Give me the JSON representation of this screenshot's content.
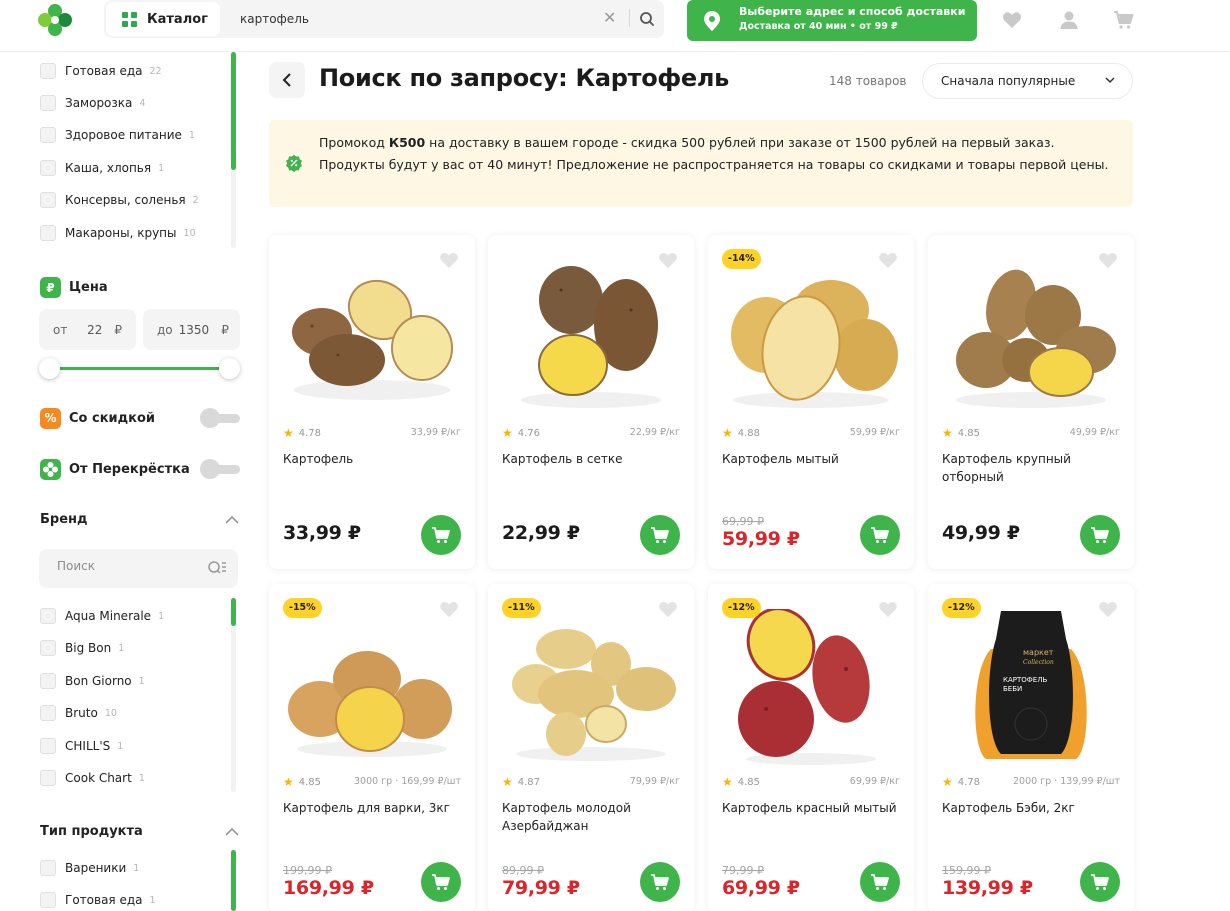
{
  "header": {
    "catalog_label": "Каталог",
    "search_value": "картофель",
    "delivery_title": "Выберите адрес и способ доставки",
    "delivery_sub": "Доставка от 40 мин • от 99 ₽"
  },
  "sidebar": {
    "categories": [
      {
        "label": "Готовая еда",
        "count": "22"
      },
      {
        "label": "Заморозка",
        "count": "4"
      },
      {
        "label": "Здоровое питание",
        "count": "1"
      },
      {
        "label": "Каша, хлопья",
        "count": "1"
      },
      {
        "label": "Консервы, соленья",
        "count": "2"
      },
      {
        "label": "Макароны, крупы",
        "count": "10"
      }
    ],
    "price": {
      "title": "Цена",
      "from_label": "от",
      "from_value": "22",
      "to_label": "до",
      "to_value": "1350",
      "currency": "₽"
    },
    "discount_toggle": "Со скидкой",
    "own_brand_toggle": "От Перекрёстка",
    "brand": {
      "title": "Бренд",
      "search_placeholder": "Поиск",
      "items": [
        {
          "label": "Aqua Minerale",
          "count": "1"
        },
        {
          "label": "Big Bon",
          "count": "1"
        },
        {
          "label": "Bon Giorno",
          "count": "1"
        },
        {
          "label": "Bruto",
          "count": "10"
        },
        {
          "label": "CHILL'S",
          "count": "1"
        },
        {
          "label": "Cook Chart",
          "count": "1"
        }
      ]
    },
    "product_type": {
      "title": "Тип продукта",
      "items": [
        {
          "label": "Вареники",
          "count": "1"
        },
        {
          "label": "Готовая еда",
          "count": "1"
        }
      ]
    }
  },
  "main": {
    "title": "Поиск по запросу:  Картофель",
    "count": "148 товаров",
    "sort": "Сначала популярные",
    "promo": {
      "pre": "Промокод ",
      "code": "К500",
      "post": " на доставку в вашем городе - скидка 500 рублей при заказе от 1500 рублей на первый заказ. Продукты будут у вас от 40 минут! Предложение не распространяется на товары со скидками и товары первой цены."
    }
  },
  "products": [
    {
      "name": "Картофель",
      "rating": "4.78",
      "unit": "33,99 ₽/кг",
      "price": "33,99 ₽",
      "old_price": "",
      "discount": ""
    },
    {
      "name": "Картофель в сетке",
      "rating": "4.76",
      "unit": "22,99 ₽/кг",
      "price": "22,99 ₽",
      "old_price": "",
      "discount": ""
    },
    {
      "name": "Картофель мытый",
      "rating": "4.88",
      "unit": "59,99 ₽/кг",
      "price": "59,99 ₽",
      "old_price": "69,99 ₽",
      "discount": "-14%"
    },
    {
      "name": "Картофель крупный отборный",
      "rating": "4.85",
      "unit": "49,99 ₽/кг",
      "price": "49,99 ₽",
      "old_price": "",
      "discount": ""
    },
    {
      "name": "Картофель для варки, 3кг",
      "rating": "4.85",
      "unit": "3000 гр · 169,99 ₽/шт",
      "price": "169,99 ₽",
      "old_price": "199,99 ₽",
      "discount": "-15%"
    },
    {
      "name": "Картофель молодой Азербайджан",
      "rating": "4.87",
      "unit": "79,99 ₽/кг",
      "price": "79,99 ₽",
      "old_price": "89,99 ₽",
      "discount": "-11%"
    },
    {
      "name": "Картофель красный мытый",
      "rating": "4.85",
      "unit": "69,99 ₽/кг",
      "price": "69,99 ₽",
      "old_price": "79,99 ₽",
      "discount": "-12%"
    },
    {
      "name": "Картофель Бэби, 2кг",
      "rating": "4.78",
      "unit": "2000 гр · 139,99 ₽/шт",
      "price": "139,99 ₽",
      "old_price": "159,99 ₽",
      "discount": "-12%"
    }
  ],
  "package_text": {
    "brand_line1": "маркет",
    "brand_line2": "Collection",
    "product_line1": "КАРТОФЕЛЬ",
    "product_line2": "БЕБИ"
  },
  "colors": {
    "accent": "#3fb44a",
    "sale_price": "#d8262b",
    "discount_badge": "#ffd228",
    "promo_bg": "#fdf7e3"
  }
}
